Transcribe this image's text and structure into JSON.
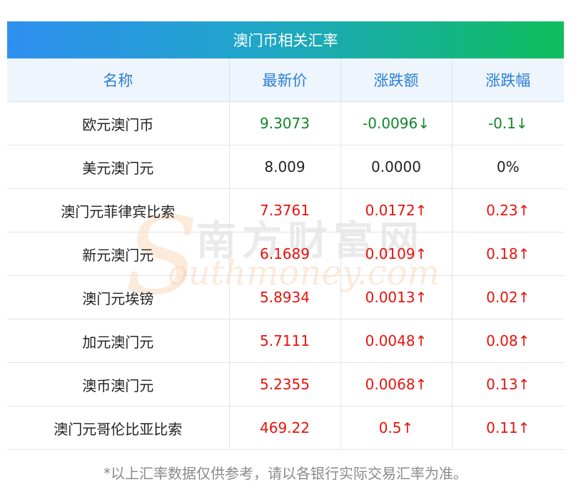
{
  "title": "澳门币相关汇率",
  "columns": [
    "名称",
    "最新价",
    "涨跌额",
    "涨跌幅"
  ],
  "rows": [
    {
      "name": "欧元澳门币",
      "price": "9.3073",
      "change": "-0.0096↓",
      "percent": "-0.1↓",
      "trend": "down"
    },
    {
      "name": "美元澳门元",
      "price": "8.009",
      "change": "0.0000",
      "percent": "0%",
      "trend": "flat"
    },
    {
      "name": "澳门元菲律宾比索",
      "price": "7.3761",
      "change": "0.0172↑",
      "percent": "0.23↑",
      "trend": "up"
    },
    {
      "name": "新元澳门元",
      "price": "6.1689",
      "change": "0.0109↑",
      "percent": "0.18↑",
      "trend": "up"
    },
    {
      "name": "澳门元埃镑",
      "price": "5.8934",
      "change": "0.0013↑",
      "percent": "0.02↑",
      "trend": "up"
    },
    {
      "name": "加元澳门元",
      "price": "5.7111",
      "change": "0.0048↑",
      "percent": "0.08↑",
      "trend": "up"
    },
    {
      "name": "澳币澳门元",
      "price": "5.2355",
      "change": "0.0068↑",
      "percent": "0.13↑",
      "trend": "up"
    },
    {
      "name": "澳门元哥伦比亚比索",
      "price": "469.22",
      "change": "0.5↑",
      "percent": "0.11↑",
      "trend": "up"
    }
  ],
  "watermark": {
    "letter": "S",
    "cn": "南方财富网",
    "en": "outhmoney.com"
  },
  "footer": "*以上汇率数据仅供参考，请以各银行实际交易汇率为准。",
  "colors": {
    "up": "#e8120c",
    "down": "#11862a",
    "flat": "#222222",
    "header_text": "#2a7fd4"
  }
}
